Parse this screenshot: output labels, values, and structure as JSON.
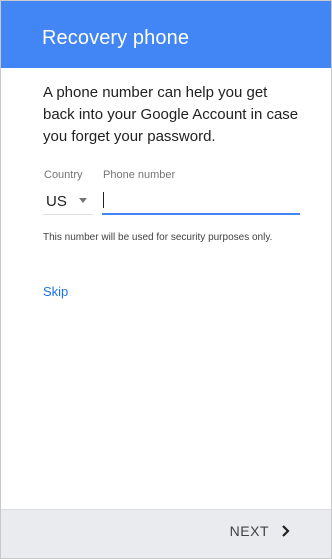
{
  "header": {
    "title": "Recovery phone"
  },
  "main": {
    "description": "A phone number can help you get back into your Google Account in case you forget your password.",
    "country": {
      "label": "Country",
      "value": "US"
    },
    "phone": {
      "label": "Phone number",
      "value": ""
    },
    "note": "This number will be used for security purposes only.",
    "skip_label": "Skip"
  },
  "footer": {
    "next_label": "NEXT"
  },
  "colors": {
    "accent": "#4285f4",
    "link": "#1a73e8",
    "footer_bg": "#e9ebee"
  },
  "icons": {
    "dropdown": "caret-down-icon",
    "next": "chevron-right-icon"
  }
}
